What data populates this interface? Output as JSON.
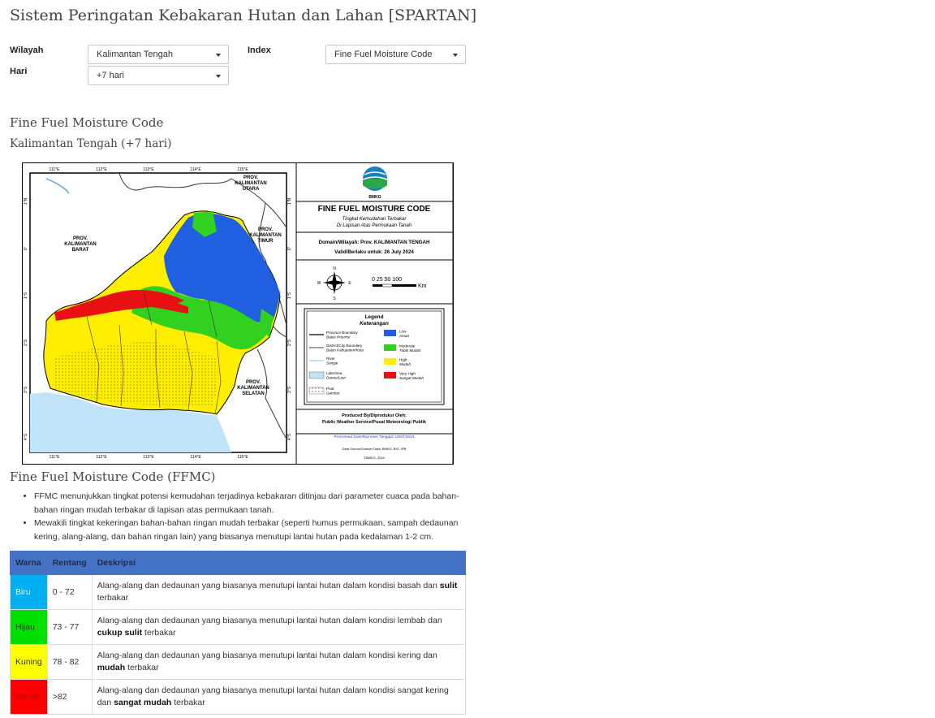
{
  "header": {
    "title": "Sistem Peringatan Kebakaran Hutan dan Lahan [SPARTAN]"
  },
  "filters": {
    "wilayah_label": "Wilayah",
    "wilayah_value": "Kalimantan Tengah",
    "hari_label": "Hari",
    "hari_value": "+7 hari",
    "index_label": "Index",
    "index_value": "Fine Fuel Moisture Code"
  },
  "section": {
    "title": "Fine Fuel Moisture Code",
    "subtitle": "Kalimantan Tengah (+7 hari)"
  },
  "map": {
    "lon_ticks": [
      "111°E",
      "112°E",
      "113°E",
      "114°E",
      "115°E"
    ],
    "lat_ticks": [
      "1°N",
      "0°",
      "1°S",
      "2°S",
      "3°S",
      "4°S"
    ],
    "region_labels": {
      "kalbar": "PROV.\nKALIMANTAN\nBARAT",
      "kaltim": "PROV.\nKALIMANTAN\nTIMUR",
      "kalut": "PROV.\nKALIMANTAN\nUTARA",
      "kalsel": "PROV.\nKALIMANTAN\nSELATAN"
    },
    "panel_title": "FINE FUEL MOISTURE CODE",
    "panel_subtitle_1": "Tingkat Kemudahan Terbakar",
    "panel_subtitle_2": "Di Lapisan Atas Permukaan Tanah",
    "domain_text": "Domain/Wilayah: Prov. KALIMANTAN TENGAH",
    "valid_text": "Valid/Berlaku untuk: 26 July 2024",
    "scale_text": "0  25 50     100",
    "scale_unit": "Km",
    "logo_text": "BMKG",
    "legend_title": "Legend",
    "legend_subtitle": "Keterangan",
    "legend_items": [
      {
        "label": "Province Boundary",
        "sub": "Batas Provinsi"
      },
      {
        "label": "District/City Boundary",
        "sub": "Batas Kabupaten/Kota"
      },
      {
        "label": "River",
        "sub": "Sungai"
      },
      {
        "label": "Lake/Sea",
        "sub": "Danau/Laut"
      },
      {
        "label": "Peat",
        "sub": "Gambut"
      }
    ],
    "class_items": [
      {
        "label": "Low",
        "sub": "Aman",
        "color": "#1f5fe0"
      },
      {
        "label": "Moderate",
        "sub": "Tidak Mudah",
        "color": "#33d11f"
      },
      {
        "label": "High",
        "sub": "Mudah",
        "color": "#ffee00"
      },
      {
        "label": "Very High",
        "sub": "Sangat Mudah",
        "color": "#e81010"
      }
    ],
    "produced_by": "Produced By/Diproduksi Oleh:",
    "produced_org": "Public Weather Service/Pusat Meteorologi Publik",
    "processed": "Processed Date/Diproses Tanggal: 19/07/2024",
    "data_source": "Data Source/Sumber Data: BMKG, BIG, IPB",
    "copyright": "©BMKG, 2024"
  },
  "ffmc": {
    "title": "Fine Fuel Moisture Code (FFMC)",
    "bullets": [
      "FFMC menunjukkan tingkat potensi kemudahan terjadinya kebakaran ditinjau dari parameter cuaca pada bahan-bahan ringan mudah terbakar di lapisan atas permukaan tanah.",
      "Mewakili tingkat kekeringan bahan-bahan ringan mudah terbakar (seperti humus permukaan, sampah dedaunan kering, alang-alang, dan bahan ringan lain) yang biasanya menutupi lantai hutan pada kedalaman 1-2 cm."
    ]
  },
  "table": {
    "headers": [
      "Warna",
      "Rentang",
      "Deskripsi"
    ],
    "rows": [
      {
        "color_name": "Biru",
        "color": "#00b0f0",
        "range": "0 - 72",
        "desc_pre": "Alang-alang dan dedaunan yang biasanya menutupi lantai hutan dalam kondisi basah dan ",
        "desc_bold": "sulit",
        "desc_post": " terbakar"
      },
      {
        "color_name": "Hijau",
        "color": "#00e000",
        "range": "73 - 77",
        "desc_pre": "Alang-alang dan dedaunan yang biasanya menutupi lantai hutan dalam kondisi lembab dan ",
        "desc_bold": "cukup sulit",
        "desc_post": " terbakar"
      },
      {
        "color_name": "Kuning",
        "color": "#ffff00",
        "range": "78 - 82",
        "desc_pre": "Alang-alang dan dedaunan yang biasanya menutupi lantai hutan dalam kondisi kering dan ",
        "desc_bold": "mudah",
        "desc_post": " terbakar"
      },
      {
        "color_name": "Merah",
        "color": "#ff0000",
        "range": ">82",
        "desc_pre": "Alang-alang dan dedaunan yang biasanya menutupi lantai hutan dalam kondisi sangat kering dan ",
        "desc_bold": "sangat mudah",
        "desc_post": " terbakar"
      }
    ]
  }
}
